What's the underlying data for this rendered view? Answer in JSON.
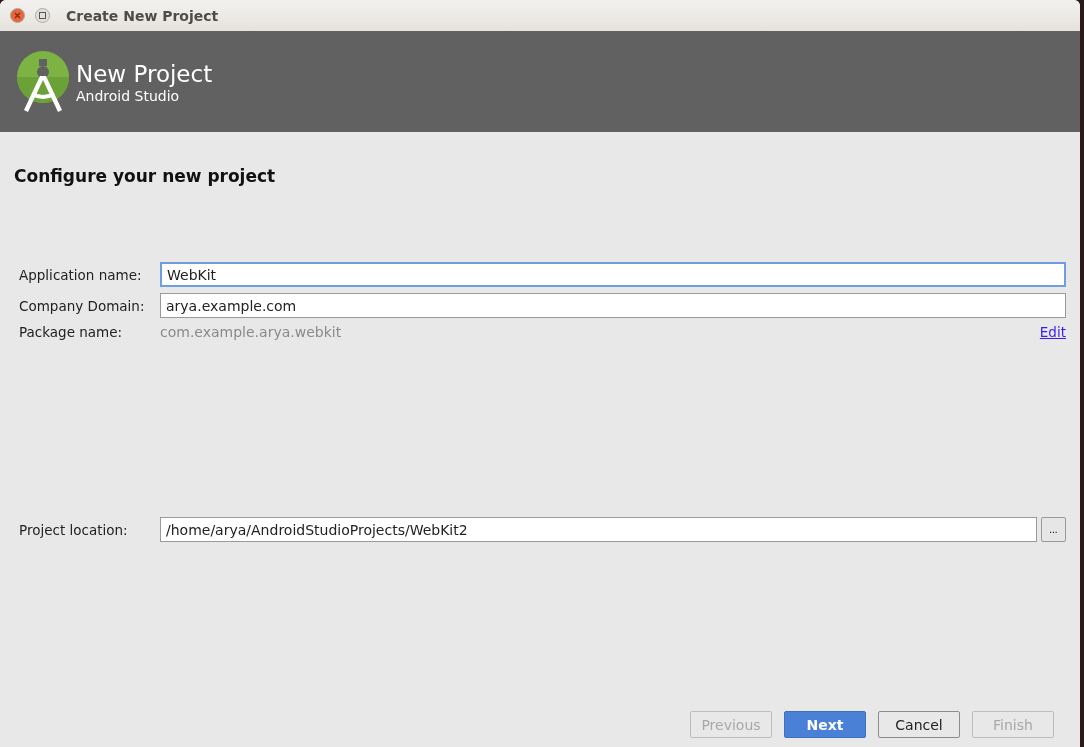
{
  "window": {
    "title": "Create New Project"
  },
  "header": {
    "title": "New Project",
    "subtitle": "Android Studio"
  },
  "heading": "Configure your new project",
  "fields": [
    {
      "label": "Application name:",
      "value": "WebKit",
      "focused": true
    },
    {
      "label": "Company Domain:",
      "value": "arya.example.com",
      "focused": false
    }
  ],
  "package": {
    "label": "Package name:",
    "value": "com.example.arya.webkit",
    "link": "Edit"
  },
  "location": {
    "label": "Project location:",
    "value": "/home/arya/AndroidStudioProjects/WebKit2",
    "browse": "..."
  },
  "buttons": [
    {
      "label": "Previous",
      "disabled": true,
      "primary": false
    },
    {
      "label": "Next",
      "disabled": false,
      "primary": true
    },
    {
      "label": "Cancel",
      "disabled": false,
      "primary": false
    },
    {
      "label": "Finish",
      "disabled": true,
      "primary": false
    }
  ]
}
